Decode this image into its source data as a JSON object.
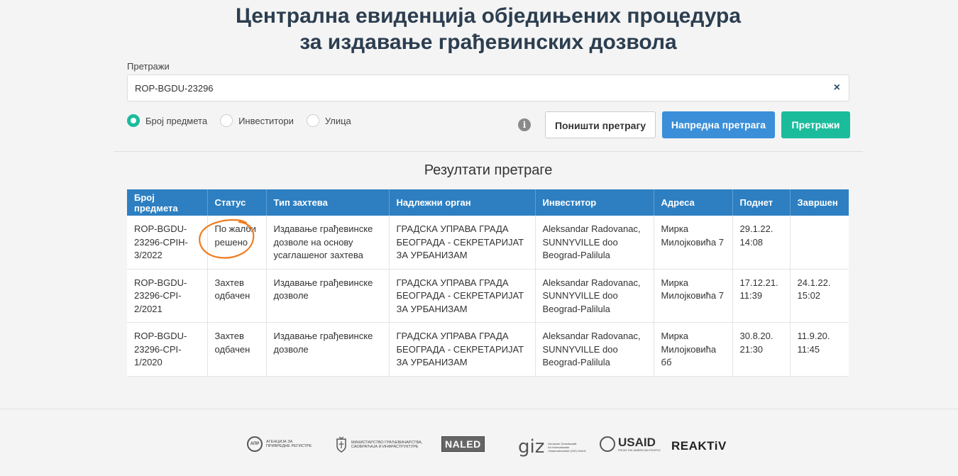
{
  "header": {
    "title_line1": "Централна евиденција обједињених процедура",
    "title_line2": "за издавање грађевинских дозвола"
  },
  "search": {
    "label": "Претражи",
    "value": "ROP-BGDU-23296",
    "clear_icon": "×",
    "radios": [
      {
        "label": "Број предмета",
        "checked": true
      },
      {
        "label": "Инвеститори",
        "checked": false
      },
      {
        "label": "Улица",
        "checked": false
      }
    ],
    "info_icon": "i",
    "reset_label": "Поништи претрагу",
    "advanced_label": "Напредна претрага",
    "search_label": "Претражи"
  },
  "results": {
    "title": "Резултати претраге",
    "columns": [
      "Број предмета",
      "Статус",
      "Тип захтева",
      "Надлежни орган",
      "Инвеститор",
      "Адреса",
      "Поднет",
      "Завршен"
    ],
    "rows": [
      {
        "number": "ROP-BGDU-23296-CPIH-3/2022",
        "status": "По жалби решено",
        "type": "Издавање грађевинске дозволе на основу усаглашеног захтева",
        "authority": "ГРАДСКА УПРАВА ГРАДА БЕОГРАДА - СЕКРЕТАРИЈАТ ЗА УРБАНИЗАМ",
        "investor": "Aleksandar Radovanac, SUNNYVILLE doo Beograd-Palilula",
        "address": "Мирка Милојковића 7",
        "submitted": "29.1.22. 14:08",
        "completed": ""
      },
      {
        "number": "ROP-BGDU-23296-CPI-2/2021",
        "status": "Захтев одбачен",
        "type": "Издавање грађевинске дозволе",
        "authority": "ГРАДСКА УПРАВА ГРАДА БЕОГРАДА - СЕКРЕТАРИЈАТ ЗА УРБАНИЗАМ",
        "investor": "Aleksandar Radovanac, SUNNYVILLE doo Beograd-Palilula",
        "address": "Мирка Милојковића 7",
        "submitted": "17.12.21. 11:39",
        "completed": "24.1.22. 15:02"
      },
      {
        "number": "ROP-BGDU-23296-CPI-1/2020",
        "status": "Захтев одбачен",
        "type": "Издавање грађевинске дозволе",
        "authority": "ГРАДСКА УПРАВА ГРАДА БЕОГРАДА - СЕКРЕТАРИЈАТ ЗА УРБАНИЗАМ",
        "investor": "Aleksandar Radovanac, SUNNYVILLE doo Beograd-Palilula",
        "address": "Мирка Милојковића бб",
        "submitted": "30.8.20. 21:30",
        "completed": "11.9.20. 11:45"
      }
    ]
  },
  "footer": {
    "logos": [
      {
        "name": "apr-logo",
        "mark": "АПР",
        "line1": "АГЕНЦИЈА ЗА",
        "line2": "ПРИВРЕДНЕ РЕГИСТРЕ"
      },
      {
        "name": "ministry-logo",
        "line1": "МИНИСТАРСТВО ГРАЂЕВИНАРСТВА,",
        "line2": "САОБРАЋАЈА И ИНФРАСТРУКТУРЕ"
      },
      {
        "name": "naled-logo",
        "text": "NALED"
      },
      {
        "name": "giz-logo",
        "text": "giz",
        "line1": "Deutsche Gesellschaft",
        "line2": "für Internationale",
        "line3": "Zusammenarbeit (GIZ) GmbH"
      },
      {
        "name": "usaid-logo",
        "text": "USAID",
        "line1": "FROM THE AMERICAN PEOPLE"
      },
      {
        "name": "reaktiv-logo",
        "text": "REAKTiV"
      }
    ]
  },
  "colors": {
    "header_blue": "#2d7fc1",
    "advanced_button": "#3a8fd8",
    "search_button": "#1abc9c",
    "annotation_orange": "#f07c1e"
  }
}
